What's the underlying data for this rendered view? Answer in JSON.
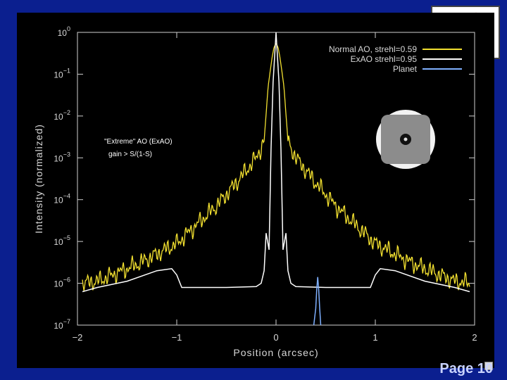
{
  "slide": {
    "page_label": "Page 10"
  },
  "chart_data": {
    "type": "line",
    "ylabel": "Intensity (normalized)",
    "xlabel": "Position (arcsec)",
    "xlim": [
      -2,
      2
    ],
    "ylim_log10": [
      -7,
      0
    ],
    "yscale": "log",
    "x_ticks": [
      -2,
      -1,
      0,
      1,
      2
    ],
    "x_tick_labels": [
      "−2",
      "−1",
      "0",
      "1",
      "2"
    ],
    "y_tick_labels": [
      {
        "base": "10",
        "exp": "0"
      },
      {
        "base": "10",
        "exp": "−1"
      },
      {
        "base": "10",
        "exp": "−2"
      },
      {
        "base": "10",
        "exp": "−3"
      },
      {
        "base": "10",
        "exp": "−4"
      },
      {
        "base": "10",
        "exp": "−5"
      },
      {
        "base": "10",
        "exp": "−6"
      },
      {
        "base": "10",
        "exp": "−7"
      }
    ],
    "legend_position": "top-right",
    "series": [
      {
        "name": "Normal AO, strehl=0.59",
        "color": "#f2e030",
        "style": "noisy",
        "x": [
          -1.95,
          -1.8,
          -1.6,
          -1.4,
          -1.2,
          -1.0,
          -0.8,
          -0.6,
          -0.4,
          -0.3,
          -0.2,
          -0.12,
          -0.08,
          -0.04,
          -0.02,
          0,
          0.02,
          0.04,
          0.08,
          0.12,
          0.2,
          0.3,
          0.4,
          0.6,
          0.8,
          1.0,
          1.2,
          1.4,
          1.6,
          1.8,
          1.95
        ],
        "y": [
          -6.0,
          -5.95,
          -5.75,
          -5.55,
          -5.3,
          -5.05,
          -4.6,
          -4.15,
          -3.6,
          -3.3,
          -3.0,
          -2.6,
          -1.3,
          -0.6,
          -0.35,
          -0.27,
          -0.35,
          -0.6,
          -1.3,
          -2.6,
          -3.0,
          -3.3,
          -3.6,
          -4.15,
          -4.6,
          -5.05,
          -5.3,
          -5.55,
          -5.75,
          -5.95,
          -6.0
        ]
      },
      {
        "name": "ExAO strehl=0.95",
        "color": "#ffffff",
        "style": "smooth",
        "x": [
          -1.95,
          -1.8,
          -1.5,
          -1.2,
          -1.05,
          -1.0,
          -0.95,
          -0.8,
          -0.5,
          -0.2,
          -0.15,
          -0.12,
          -0.1,
          -0.07,
          -0.05,
          -0.03,
          0,
          0.03,
          0.05,
          0.07,
          0.1,
          0.12,
          0.15,
          0.2,
          0.5,
          0.8,
          0.95,
          1.0,
          1.05,
          1.2,
          1.5,
          1.8,
          1.95
        ],
        "y": [
          -6.2,
          -6.1,
          -5.95,
          -5.7,
          -5.65,
          -5.8,
          -6.1,
          -6.1,
          -6.1,
          -6.08,
          -6.0,
          -5.7,
          -4.8,
          -5.2,
          -2.8,
          -1.2,
          0,
          -1.2,
          -2.8,
          -5.2,
          -4.8,
          -5.7,
          -6.0,
          -6.08,
          -6.1,
          -6.1,
          -6.1,
          -5.8,
          -5.65,
          -5.7,
          -5.95,
          -6.1,
          -6.2
        ]
      },
      {
        "name": "Planet",
        "color": "#7fb0ff",
        "style": "smooth",
        "x": [
          0.38,
          0.4,
          0.41,
          0.42,
          0.43,
          0.44,
          0.45
        ],
        "y": [
          -7.0,
          -6.6,
          -6.15,
          -5.85,
          -6.15,
          -6.6,
          -7.0
        ]
      }
    ],
    "annotations": [
      "\"Extreme\" AO (ExAO)",
      "gain > S/(1-S)"
    ]
  }
}
